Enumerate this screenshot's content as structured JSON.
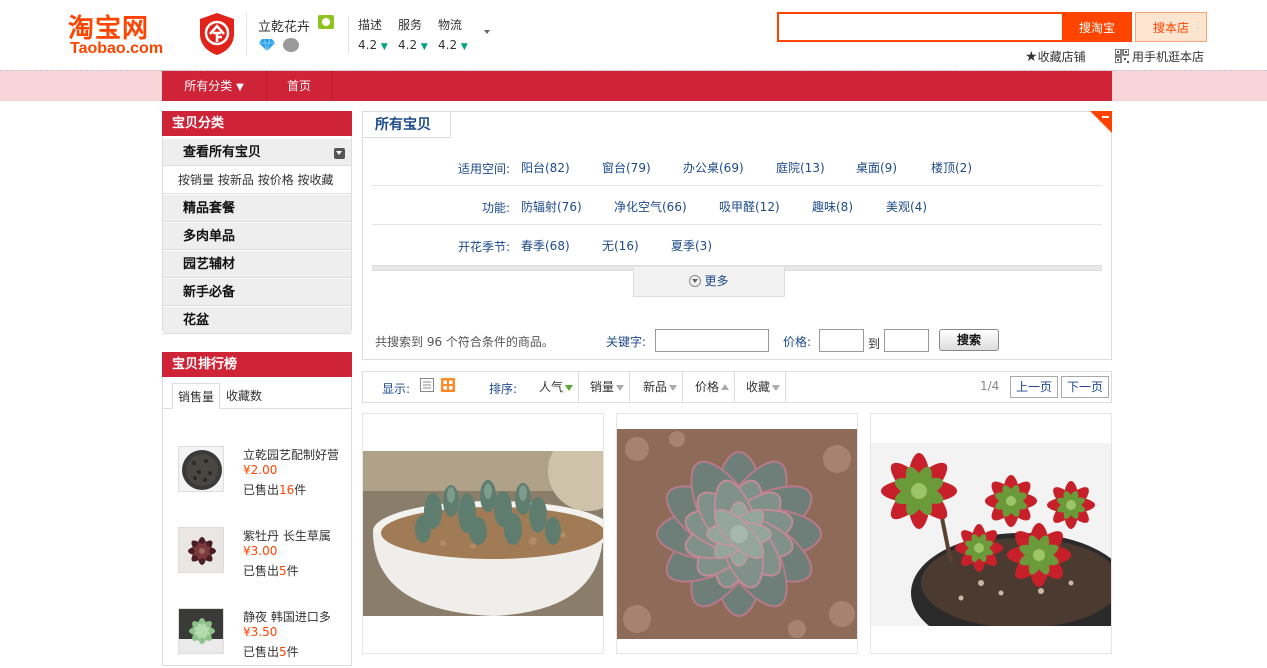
{
  "header": {
    "logo_cn": "淘宝网",
    "logo_en": "Taobao.com",
    "shop_name": "立乾花卉",
    "ratings": [
      {
        "label": "描述",
        "value": "4.2"
      },
      {
        "label": "服务",
        "value": "4.2"
      },
      {
        "label": "物流",
        "value": "4.2"
      }
    ],
    "search_placeholder": "",
    "search_taobao_label": "搜淘宝",
    "search_shop_label": "搜本店",
    "fav_shop_label": "收藏店铺",
    "mobile_label": "用手机逛本店"
  },
  "nav": {
    "all_categories": "所有分类",
    "home": "首页"
  },
  "sidebar": {
    "category_title": "宝贝分类",
    "view_all": "查看所有宝贝",
    "sort_links": [
      "按销量",
      "按新品",
      "按价格",
      "按收藏"
    ],
    "categories": [
      "精品套餐",
      "多肉单品",
      "园艺辅材",
      "新手必备",
      "花盆"
    ],
    "rank_title": "宝贝排行榜",
    "rank_tabs": [
      "销售量",
      "收藏数"
    ],
    "rank_items": [
      {
        "name": "立乾园艺配制好营",
        "price": "¥2.00",
        "sold_prefix": "已售出",
        "sold": "16",
        "sold_suffix": "件"
      },
      {
        "name": "紫牡丹 长生草属",
        "price": "¥3.00",
        "sold_prefix": "已售出",
        "sold": "5",
        "sold_suffix": "件"
      },
      {
        "name": "静夜 韩国进口多",
        "price": "¥3.50",
        "sold_prefix": "已售出",
        "sold": "5",
        "sold_suffix": "件"
      }
    ]
  },
  "filter": {
    "title": "所有宝贝",
    "rows": [
      {
        "label": "适用空间:",
        "options": [
          "阳台(82)",
          "窗台(79)",
          "办公桌(69)",
          "庭院(13)",
          "桌面(9)",
          "楼顶(2)"
        ]
      },
      {
        "label": "功能:",
        "options": [
          "防辐射(76)",
          "净化空气(66)",
          "吸甲醛(12)",
          "趣味(8)",
          "美观(4)"
        ]
      },
      {
        "label": "开花季节:",
        "options": [
          "春季(68)",
          "无(16)",
          "夏季(3)"
        ]
      }
    ],
    "more_label": "更多",
    "found_text": "共搜索到 96 个符合条件的商品。",
    "keyword_label": "关键字:",
    "price_label": "价格:",
    "to_label": "到",
    "search_label": "搜索"
  },
  "sortbar": {
    "display_label": "显示:",
    "sort_label": "排序:",
    "options": [
      "人气",
      "销量",
      "新品",
      "价格",
      "收藏"
    ],
    "page_info": "1/4",
    "prev_label": "上一页",
    "next_label": "下一页"
  },
  "colors": {
    "brand": "#ff4400",
    "nav_red": "#cf2338",
    "link_blue": "#1e4a8c"
  }
}
